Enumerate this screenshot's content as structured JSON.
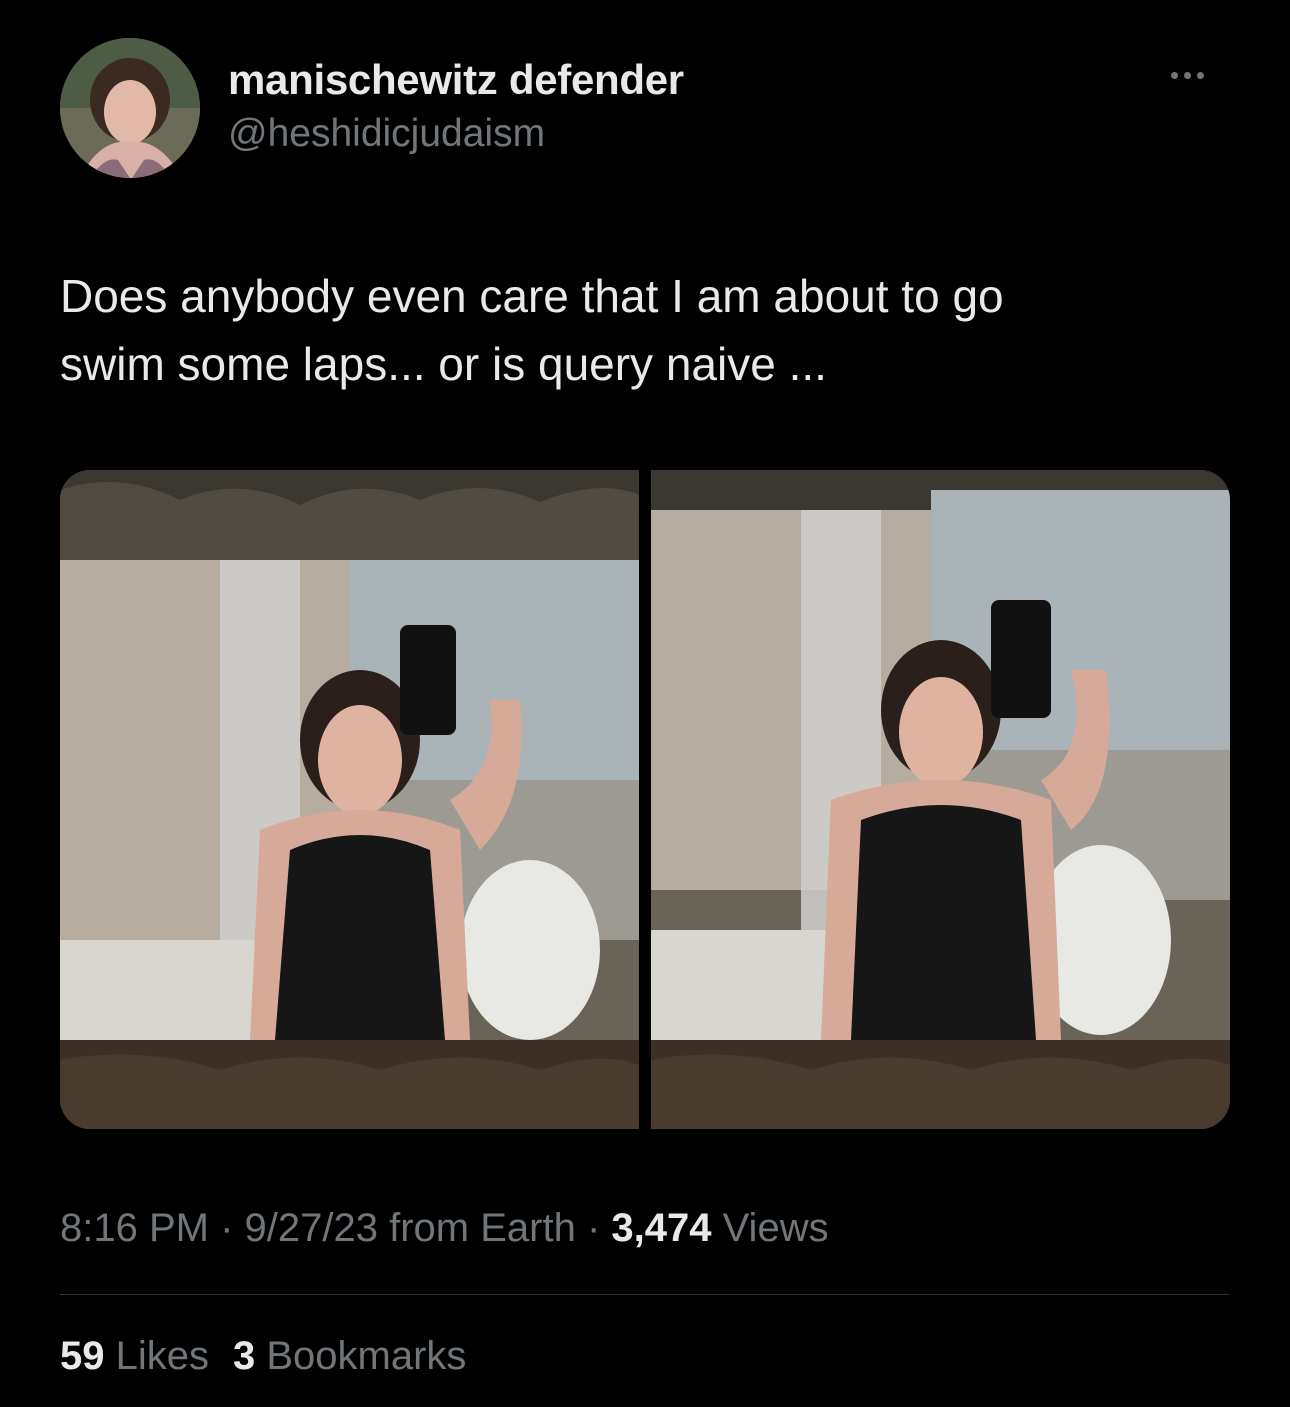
{
  "author": {
    "display_name": "manischewitz defender",
    "handle": "@heshidicjudaism"
  },
  "icons": {
    "more": "more-horizontal-icon"
  },
  "tweet": {
    "text_line1": "Does anybody even care that I am about to go",
    "text_line2": "swim some laps... or is query naive ..."
  },
  "meta": {
    "time": "8:16 PM",
    "sep1": " · ",
    "date": "9/27/23",
    "source": " from Earth",
    "sep2": " · ",
    "views_count": "3,474",
    "views_label": " Views"
  },
  "stats": {
    "likes_count": "59",
    "likes_label": " Likes",
    "bookmarks_count": "3",
    "bookmarks_label": " Bookmarks"
  },
  "colors": {
    "background": "#000000",
    "primary_text": "#e7e9ea",
    "secondary_text": "#71767b",
    "divider": "#2f3336"
  }
}
